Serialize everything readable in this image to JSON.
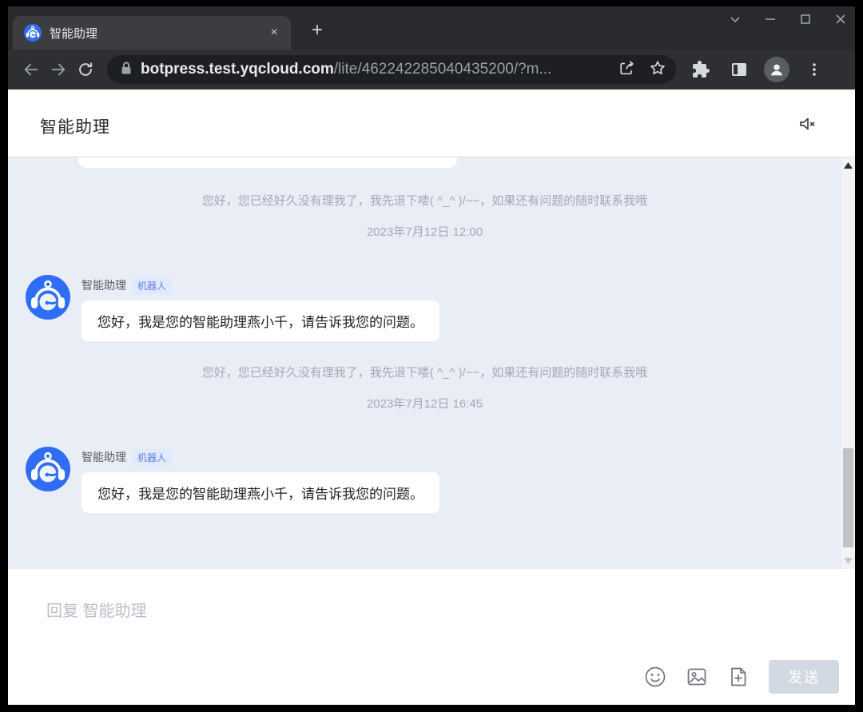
{
  "browser": {
    "tab_title": "智能助理",
    "new_tab_label": "+",
    "close_tab_label": "×",
    "url_host": "botpress.test.yqcloud.com",
    "url_path": "/lite/462242285040435200/?m..."
  },
  "header": {
    "title": "智能助理"
  },
  "chat": {
    "groups": [
      {
        "system_message": "您好，您已经好久没有理我了，我先退下喽( ^_^ )/~~，如果还有问题的随时联系我哦",
        "timestamp": "2023年7月12日 12:00",
        "sender": "智能助理",
        "sender_badge": "机器人",
        "message": "您好，我是您的智能助理燕小千，请告诉我您的问题。"
      },
      {
        "system_message": "您好，您已经好久没有理我了，我先退下喽( ^_^ )/~~，如果还有问题的随时联系我哦",
        "timestamp": "2023年7月12日 16:45",
        "sender": "智能助理",
        "sender_badge": "机器人",
        "message": "您好，我是您的智能助理燕小千，请告诉我您的问题。"
      }
    ]
  },
  "composer": {
    "placeholder": "回复 智能助理",
    "send_label": "发送"
  },
  "colors": {
    "accent_blue": "#2f6ef4",
    "badge_text": "#5d7ef2",
    "badge_bg": "#e1e9fc",
    "chat_bg": "#e9edf6",
    "send_button_bg": "#d3d9e3",
    "chrome_frame": "#292a2d",
    "chrome_toolbar": "#2e2f33",
    "omnibox_bg": "#1e1f22"
  }
}
